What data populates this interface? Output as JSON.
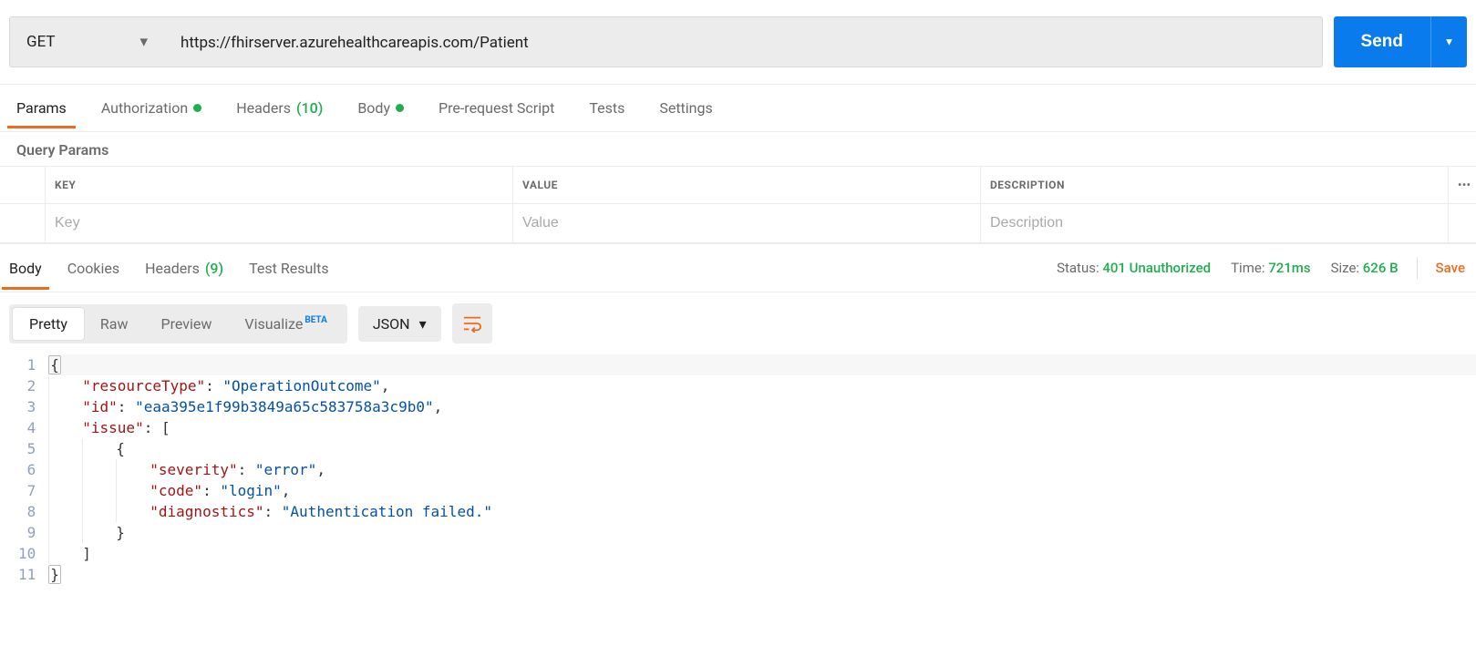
{
  "request": {
    "method": "GET",
    "url": "https://fhirserver.azurehealthcareapis.com/Patient",
    "send_label": "Send"
  },
  "request_tabs": {
    "params": "Params",
    "auth": "Authorization",
    "headers": "Headers",
    "headers_count": "(10)",
    "body": "Body",
    "prerequest": "Pre-request Script",
    "tests": "Tests",
    "settings": "Settings"
  },
  "query_params": {
    "section_label": "Query Params",
    "headers": {
      "key": "KEY",
      "value": "VALUE",
      "description": "DESCRIPTION"
    },
    "placeholders": {
      "key": "Key",
      "value": "Value",
      "description": "Description"
    }
  },
  "response_tabs": {
    "body": "Body",
    "cookies": "Cookies",
    "headers": "Headers",
    "headers_count": "(9)",
    "tests": "Test Results"
  },
  "response_meta": {
    "status_label": "Status:",
    "status_value": "401 Unauthorized",
    "time_label": "Time:",
    "time_value": "721ms",
    "size_label": "Size:",
    "size_value": "626 B",
    "save_label": "Save"
  },
  "viewmodes": {
    "pretty": "Pretty",
    "raw": "Raw",
    "preview": "Preview",
    "visualize": "Visualize",
    "visualize_badge": "BETA",
    "format": "JSON"
  },
  "code": {
    "lines": [
      {
        "n": "1",
        "indent": 0,
        "tokens": [
          {
            "t": "brace",
            "v": "{"
          }
        ],
        "first": true,
        "box": true
      },
      {
        "n": "2",
        "indent": 1,
        "tokens": [
          {
            "t": "key",
            "v": "\"resourceType\""
          },
          {
            "t": "colon",
            "v": ":"
          },
          {
            "t": "sp",
            "v": " "
          },
          {
            "t": "str",
            "v": "\"OperationOutcome\""
          },
          {
            "t": "punc",
            "v": ","
          }
        ]
      },
      {
        "n": "3",
        "indent": 1,
        "tokens": [
          {
            "t": "key",
            "v": "\"id\""
          },
          {
            "t": "colon",
            "v": ":"
          },
          {
            "t": "sp",
            "v": " "
          },
          {
            "t": "str",
            "v": "\"eaa395e1f99b3849a65c583758a3c9b0\""
          },
          {
            "t": "punc",
            "v": ","
          }
        ]
      },
      {
        "n": "4",
        "indent": 1,
        "tokens": [
          {
            "t": "key",
            "v": "\"issue\""
          },
          {
            "t": "colon",
            "v": ":"
          },
          {
            "t": "sp",
            "v": " "
          },
          {
            "t": "brace",
            "v": "["
          }
        ]
      },
      {
        "n": "5",
        "indent": 2,
        "tokens": [
          {
            "t": "brace",
            "v": "{"
          }
        ]
      },
      {
        "n": "6",
        "indent": 3,
        "tokens": [
          {
            "t": "key",
            "v": "\"severity\""
          },
          {
            "t": "colon",
            "v": ":"
          },
          {
            "t": "sp",
            "v": " "
          },
          {
            "t": "str",
            "v": "\"error\""
          },
          {
            "t": "punc",
            "v": ","
          }
        ]
      },
      {
        "n": "7",
        "indent": 3,
        "tokens": [
          {
            "t": "key",
            "v": "\"code\""
          },
          {
            "t": "colon",
            "v": ":"
          },
          {
            "t": "sp",
            "v": " "
          },
          {
            "t": "str",
            "v": "\"login\""
          },
          {
            "t": "punc",
            "v": ","
          }
        ]
      },
      {
        "n": "8",
        "indent": 3,
        "tokens": [
          {
            "t": "key",
            "v": "\"diagnostics\""
          },
          {
            "t": "colon",
            "v": ":"
          },
          {
            "t": "sp",
            "v": " "
          },
          {
            "t": "str",
            "v": "\"Authentication failed.\""
          }
        ]
      },
      {
        "n": "9",
        "indent": 2,
        "tokens": [
          {
            "t": "brace",
            "v": "}"
          }
        ]
      },
      {
        "n": "10",
        "indent": 1,
        "tokens": [
          {
            "t": "brace",
            "v": "]"
          }
        ]
      },
      {
        "n": "11",
        "indent": 0,
        "tokens": [
          {
            "t": "brace",
            "v": "}"
          }
        ],
        "box": true
      }
    ]
  }
}
